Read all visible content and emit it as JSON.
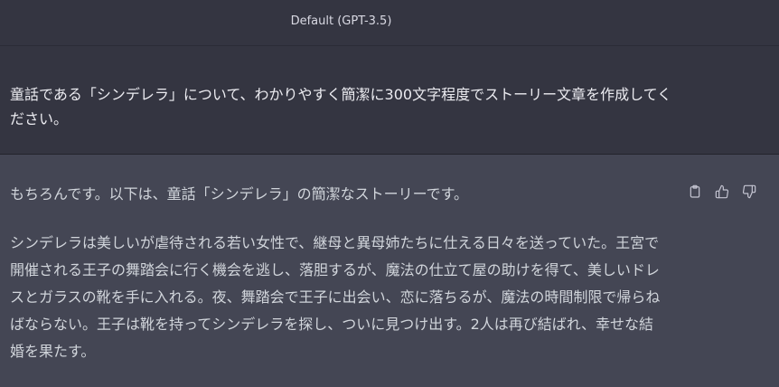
{
  "header": {
    "model_label": "Default (GPT-3.5)"
  },
  "conversation": {
    "user_message": "童話である「シンデレラ」について、わかりやすく簡潔に300文字程度でストーリー文章を作成してください。",
    "assistant_intro": "もちろんです。以下は、童話「シンデレラ」の簡潔なストーリーです。",
    "assistant_story": "シンデレラは美しいが虐待される若い女性で、継母と異母姉たちに仕える日々を送っていた。王宮で開催される王子の舞踏会に行く機会を逃し、落胆するが、魔法の仕立て屋の助けを得て、美しいドレスとガラスの靴を手に入れる。夜、舞踏会で王子に出会い、恋に落ちるが、魔法の時間制限で帰らねばならない。王子は靴を持ってシンデレラを探し、ついに見つけ出す。2人は再び結ばれ、幸せな結婚を果たす。"
  },
  "actions": [
    {
      "icon": "clipboard-icon"
    },
    {
      "icon": "thumbs-up-icon"
    },
    {
      "icon": "thumbs-down-icon"
    }
  ],
  "colors": {
    "user_bg": "#343541",
    "assistant_bg": "#444654",
    "text": "#ececf1"
  }
}
